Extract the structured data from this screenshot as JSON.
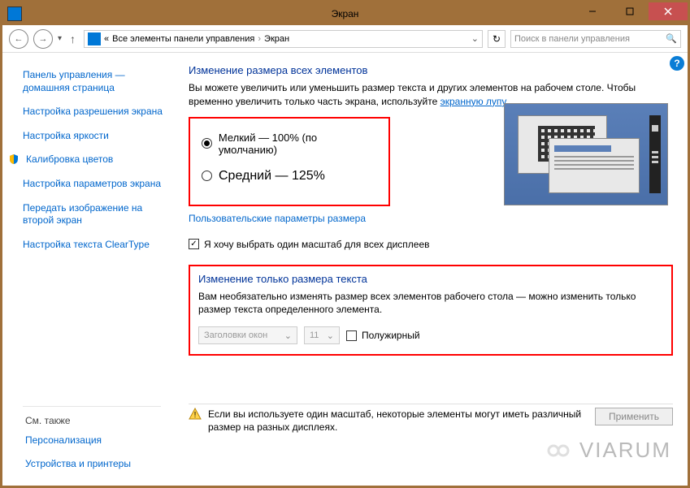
{
  "window": {
    "title": "Экран"
  },
  "nav": {
    "breadcrumb_prefix": "«",
    "breadcrumb_parent": "Все элементы панели управления",
    "breadcrumb_current": "Экран",
    "search_placeholder": "Поиск в панели управления"
  },
  "sidebar": {
    "home1": "Панель управления —",
    "home2": "домашняя страница",
    "items": [
      "Настройка разрешения экрана",
      "Настройка яркости",
      "Калибровка цветов",
      "Настройка параметров экрана",
      "Передать изображение на второй экран",
      "Настройка текста ClearType"
    ],
    "see_also_header": "См. также",
    "see_also": [
      "Персонализация",
      "Устройства и принтеры"
    ]
  },
  "main": {
    "heading1": "Изменение размера всех элементов",
    "desc_a": "Вы можете увеличить или уменьшить размер текста и других элементов на рабочем столе. Чтобы временно увеличить только часть экрана, используйте ",
    "desc_link": "экранную лупу",
    "radio_small": "Мелкий — 100% (по умолчанию)",
    "radio_medium": "Средний — 125%",
    "custom_link": "Пользовательские параметры размера",
    "checkbox_label": "Я хочу выбрать один масштаб для всех дисплеев",
    "heading2": "Изменение только размера текста",
    "desc2": "Вам необязательно изменять размер всех элементов рабочего стола — можно изменить только размер текста определенного элемента.",
    "select_element": "Заголовки окон",
    "select_size": "11",
    "bold_label": "Полужирный",
    "footer_warning": "Если вы используете один масштаб, некоторые элементы могут иметь различный размер на разных дисплеях.",
    "apply_button": "Применить"
  },
  "watermark": "VIARUM"
}
